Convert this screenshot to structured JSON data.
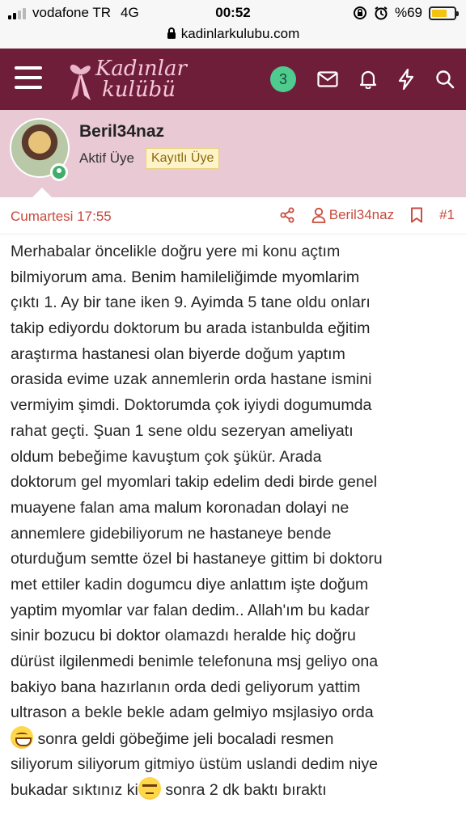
{
  "status_bar": {
    "carrier": "vodafone TR",
    "network": "4G",
    "time": "00:52",
    "battery": "%69",
    "battery_level": 0.69
  },
  "browser": {
    "url": "kadinlarkulubu.com"
  },
  "header": {
    "logo_line1": "Kadınlar",
    "logo_line2": "kulübü",
    "notification_count": "3",
    "icons": [
      "menu-icon",
      "mail-icon",
      "bell-icon",
      "bolt-icon",
      "search-icon"
    ],
    "colors": {
      "header_bg": "#6f1e3a",
      "badge_bg": "#4ecb8f",
      "logo_text": "#f4c7d8"
    }
  },
  "user": {
    "name": "Beril34naz",
    "title": "Aktif Üye",
    "banner": "Kayıtlı Üye",
    "online": true
  },
  "post": {
    "date": "Cumartesi 17:55",
    "author": "Beril34naz",
    "number": "#1",
    "lines": [
      "Merhabalar öncelikle doğru yere mi konu açtım",
      "bilmiyorum ama. Benim hamileliğimde myomlarim",
      "çıktı 1. Ay bir tane iken 9. Ayimda 5 tane oldu onları",
      "takip ediyordu doktorum bu arada istanbulda eğitim",
      "araştırma hastanesi olan biyerde doğum yaptım",
      "orasida evime uzak annemlerin orda hastane ismini",
      "vermiyim şimdi. Doktorumda çok iyiydi dogumumda",
      "rahat geçti. Şuan 1 sene oldu sezeryan ameliyatı",
      "oldum bebeğime kavuştum çok şükür. Arada",
      "doktorum gel myomlari takip edelim dedi birde genel",
      "muayene falan ama malum koronadan dolayi ne",
      "annemlere gidebiliyorum ne hastaneye bende",
      "oturduğum semtte özel bi hastaneye gittim bi doktoru",
      "met ettiler kadin dogumcu diye anlattım işte doğum",
      "yaptim myomlar var falan dedim.. Allah'ım bu kadar",
      "sinir bozucu bi doktor olamazdı heralde hiç doğru",
      "dürüst ilgilenmedi benimle telefonuna msj geliyo ona",
      "bakiyo bana hazırlanın orda dedi geliyorum yattim",
      "ultrason a bekle bekle adam gelmiyo msjlasiyo orda"
    ],
    "line20_text": " sonra geldi göbeğime jeli bocaladi resmen",
    "line21": "siliyorum siliyorum gitmiyo üstüm uslandi dedim niye",
    "line22_before": "bukadar sıktınız ki",
    "line22_after": " sonra 2 dk baktı bıraktı",
    "emojis": [
      "grinning-face-icon",
      "unamused-face-icon"
    ],
    "colors": {
      "meta_text": "#c84a3c",
      "body_text": "#262626",
      "user_block_bg": "#e9c9d4"
    }
  }
}
